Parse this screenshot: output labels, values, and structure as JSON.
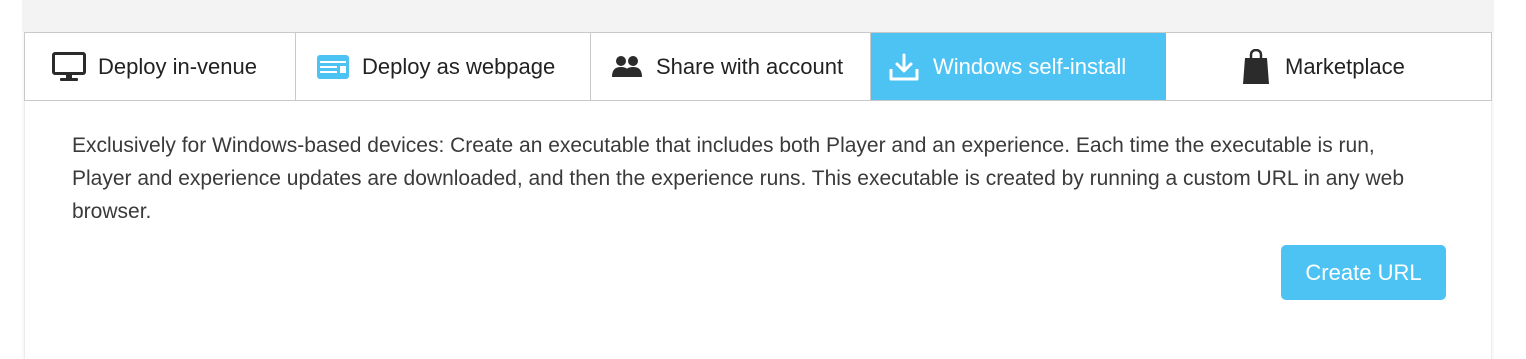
{
  "tabs": [
    {
      "label": "Deploy in-venue",
      "icon": "monitor-icon",
      "active": false
    },
    {
      "label": "Deploy as webpage",
      "icon": "webpage-icon",
      "active": false
    },
    {
      "label": "Share with account",
      "icon": "users-icon",
      "active": false
    },
    {
      "label": "Windows self-install",
      "icon": "download-icon",
      "active": true
    },
    {
      "label": "Marketplace",
      "icon": "shopping-bag-icon",
      "active": false
    }
  ],
  "panel": {
    "description": "Exclusively for Windows-based devices: Create an executable that includes both Player and an experience. Each time the executable is run, Player and experience updates are downloaded, and then the experience runs. This executable is created by running a custom URL in any web browser.",
    "create_button_label": "Create URL"
  },
  "colors": {
    "accent": "#4dc3f4",
    "tab_border": "#c9c9c9",
    "text": "#3a3a3a"
  }
}
